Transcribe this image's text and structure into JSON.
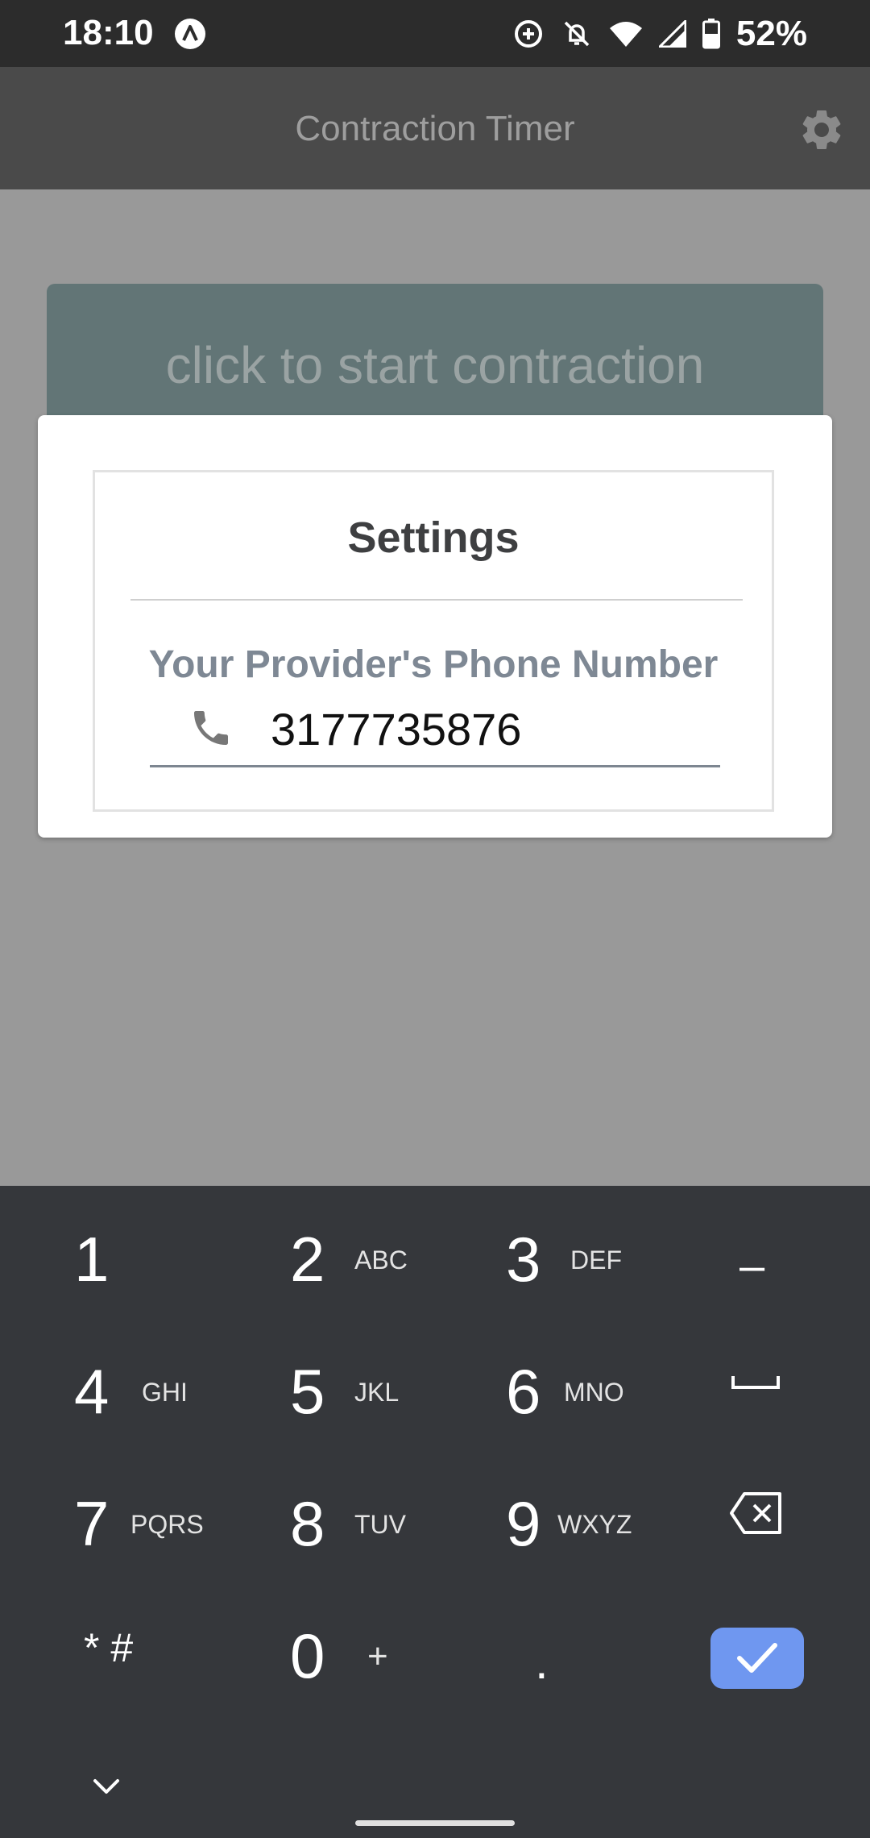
{
  "status_bar": {
    "time": "18:10",
    "battery_percent": "52%",
    "icons": [
      "a-icon",
      "data-saver-icon",
      "notifications-off-icon",
      "wifi-icon",
      "signal-icon",
      "battery-icon"
    ]
  },
  "app_bar": {
    "title": "Contraction Timer",
    "settings_icon": "gear-icon"
  },
  "start_button": {
    "label": "click to start contraction"
  },
  "dialog": {
    "title": "Settings",
    "field_label": "Your Provider's Phone Number",
    "phone_icon": "phone-icon",
    "phone_value": "3177735876"
  },
  "keyboard": {
    "keys": [
      {
        "num": "1",
        "letters": ""
      },
      {
        "num": "2",
        "letters": "ABC"
      },
      {
        "num": "3",
        "letters": "DEF"
      },
      {
        "num": "–",
        "letters": ""
      },
      {
        "num": "4",
        "letters": "GHI"
      },
      {
        "num": "5",
        "letters": "JKL"
      },
      {
        "num": "6",
        "letters": "MNO"
      },
      {
        "num": "7",
        "letters": "PQRS"
      },
      {
        "num": "8",
        "letters": "TUV"
      },
      {
        "num": "9",
        "letters": "WXYZ"
      },
      {
        "num": "* #",
        "letters": ""
      },
      {
        "num": "0",
        "letters": "+"
      },
      {
        "num": ".",
        "letters": ""
      }
    ],
    "special_icons": [
      "space-icon",
      "backspace-icon",
      "check-icon",
      "chevron-down-icon"
    ]
  },
  "colors": {
    "app_bar": "#4a4a4a",
    "start_button": "#627576",
    "keyboard": "#35373b",
    "done_key": "#6f97f0"
  }
}
